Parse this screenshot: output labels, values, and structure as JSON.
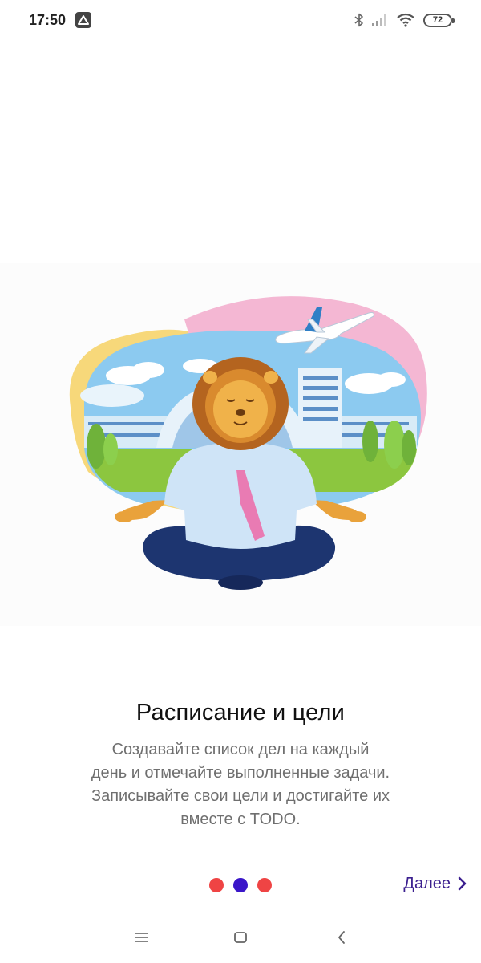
{
  "status_bar": {
    "time": "17:50",
    "battery": "72",
    "icons": [
      "app-notification-icon",
      "bluetooth-icon",
      "signal-icon",
      "wifi-icon",
      "battery-icon"
    ]
  },
  "onboarding": {
    "title": "Расписание и цели",
    "description_lines": [
      "Создавайте список дел на каждый",
      "день и отмечайте выполненные задачи.",
      "Записывайте свои цели и достигайте их",
      "вместе с TODO."
    ],
    "illustration": "lion-meditating-airport-illustration",
    "page_index": 2,
    "page_count": 3
  },
  "pager": {
    "active_color": "#3a16c9",
    "inactive_color": "#ef4444"
  },
  "next_button": {
    "label": "Далее",
    "color": "#3b1f8f"
  },
  "nav_bar": {
    "buttons": [
      "menu-icon",
      "home-icon",
      "back-icon"
    ]
  }
}
